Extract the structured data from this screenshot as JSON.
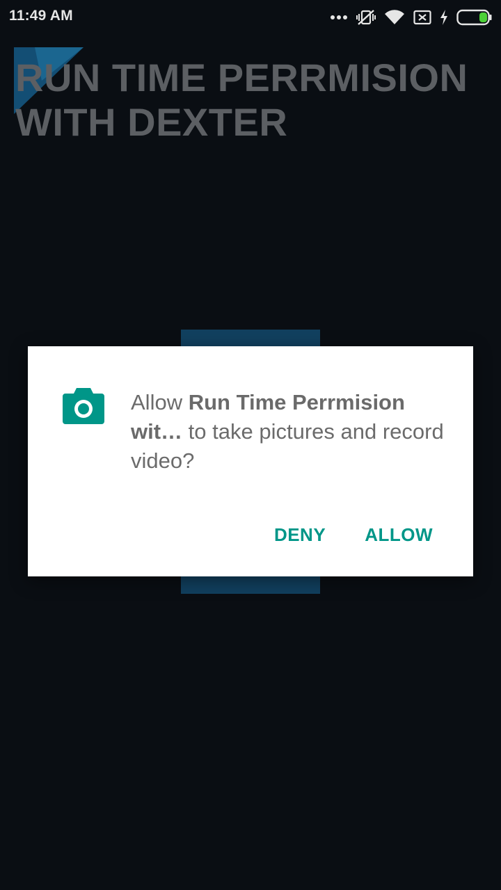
{
  "status_bar": {
    "time": "11:49 AM",
    "icons": [
      "more-dots-icon",
      "vibrate-mute-icon",
      "wifi-icon",
      "sim-none-icon",
      "charging-bolt-icon",
      "battery-icon"
    ],
    "battery_color": "#4cd137"
  },
  "app": {
    "title": "RUN TIME PERRMISION WITH DEXTER",
    "title_color": "#5c5f63",
    "button_color": "#11405f"
  },
  "dialog": {
    "icon": "camera-icon",
    "message_prefix": "Allow ",
    "app_name": "Run Time Perrmision wit…",
    "message_suffix": " to take pictures and record video?",
    "deny_label": "DENY",
    "allow_label": "ALLOW",
    "accent_color": "#009688"
  }
}
